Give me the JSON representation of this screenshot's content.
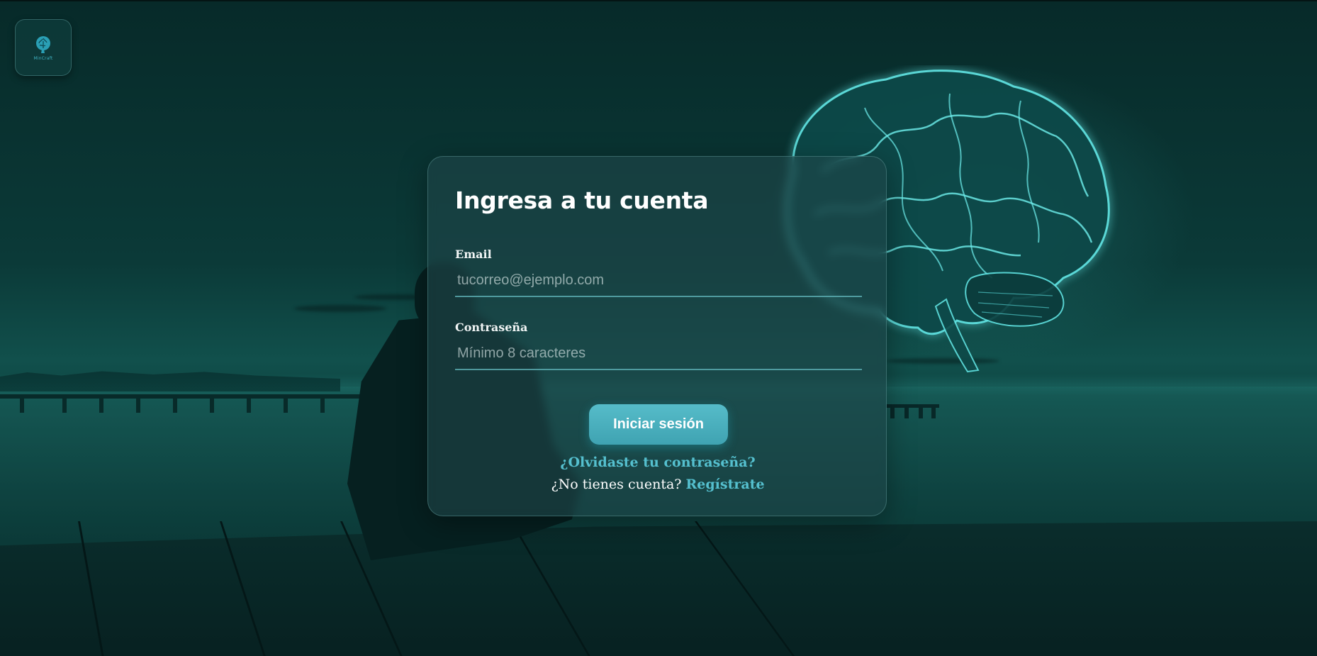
{
  "app": {
    "logo_text": "MinCraft",
    "logo_icon": "brain-icon"
  },
  "login": {
    "title": "Ingresa a tu cuenta",
    "email_label": "Email",
    "email_value": "",
    "email_placeholder": "tucorreo@ejemplo.com",
    "password_label": "Contraseña",
    "password_value": "",
    "password_placeholder": "Mínimo 8 caracteres",
    "submit_label": "Iniciar sesión",
    "forgot_label": "¿Olvidaste tu contraseña?",
    "register_prompt": "¿No tienes cuenta?",
    "register_label": "Regístrate"
  },
  "colors": {
    "accent": "#55c0cf",
    "button": "#4ab0bf",
    "background": "#0b3a38"
  }
}
